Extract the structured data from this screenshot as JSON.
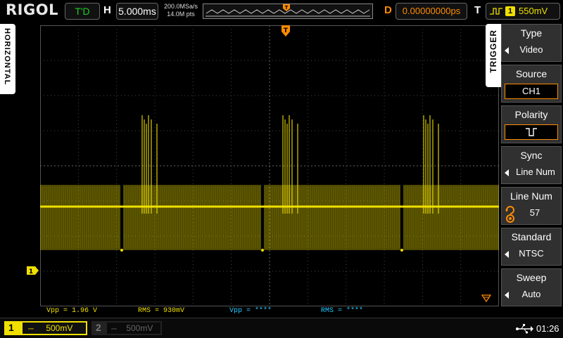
{
  "header": {
    "logo": "RIGOL",
    "trigger_status": "T'D",
    "horizontal_label": "H",
    "timebase": "5.000ms",
    "sample_rate": "200.0MSa/s",
    "memory_depth": "14.0M pts",
    "delay_label": "D",
    "delay": "0.00000000ps",
    "trigger_label": "T",
    "trigger_channel": "1",
    "trigger_level": "550mV"
  },
  "horizontal_tab": "HORIZONTAL",
  "trigger_tab": "TRIGGER",
  "menu": [
    {
      "title": "Type",
      "value": "Video"
    },
    {
      "title": "Source",
      "value": "CH1"
    },
    {
      "title": "Polarity",
      "value": "⊥⊥"
    },
    {
      "title": "Sync",
      "value": "Line Num"
    },
    {
      "title": "Line Num",
      "value": "57"
    },
    {
      "title": "Standard",
      "value": "NTSC"
    },
    {
      "title": "Sweep",
      "value": "Auto"
    }
  ],
  "measurements": [
    {
      "label": "Vpp = 1.96 V",
      "color": "#f0e000"
    },
    {
      "label": "RMS = 930mV",
      "color": "#f0e000"
    },
    {
      "label": "Vpp = ****",
      "color": "#22ccff"
    },
    {
      "label": "RMS = ****",
      "color": "#22ccff"
    }
  ],
  "channels": {
    "ch1": {
      "num": "1",
      "scale": "500mV"
    },
    "ch2": {
      "num": "2",
      "scale": "500mV"
    }
  },
  "channel_marker": "1",
  "status": {
    "clock": "01:26"
  },
  "colors": {
    "ch1": "#f0e000",
    "accent": "#ff8c00",
    "ch2": "#22ccff"
  }
}
